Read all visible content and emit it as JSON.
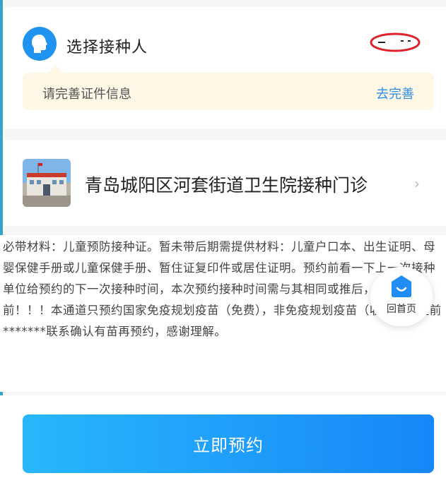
{
  "recipient": {
    "label": "选择接种人"
  },
  "tip": {
    "text": "请完善证件信息",
    "link": "去完善"
  },
  "clinic": {
    "name": "青岛城阳区河套街道卫生院接种门诊"
  },
  "notice": {
    "text": "必带材料：儿童预防接种证。暂未带后期需提供材料：儿童户口本、出生证明、母婴保健手册或儿童保健手册、暂住证复印件或居住证明。预约前看一下上一次接种单位给预约的下一次接种时间，本次预约接种时间需与其相同或推后，不能提前！！！本通道只预约国家免疫规划疫苗（免费），非免疫规划疫苗（收费）请提前*******联系确认有苗再预约，感谢理解。"
  },
  "float_home": {
    "label": "回首页"
  },
  "book_button": {
    "label": "立即预约"
  },
  "colors": {
    "accent": "#1f93ef",
    "tip_bg": "#fff7e6",
    "link": "#2f8ee8",
    "button_from": "#28b7fb",
    "button_to": "#1687fa"
  }
}
